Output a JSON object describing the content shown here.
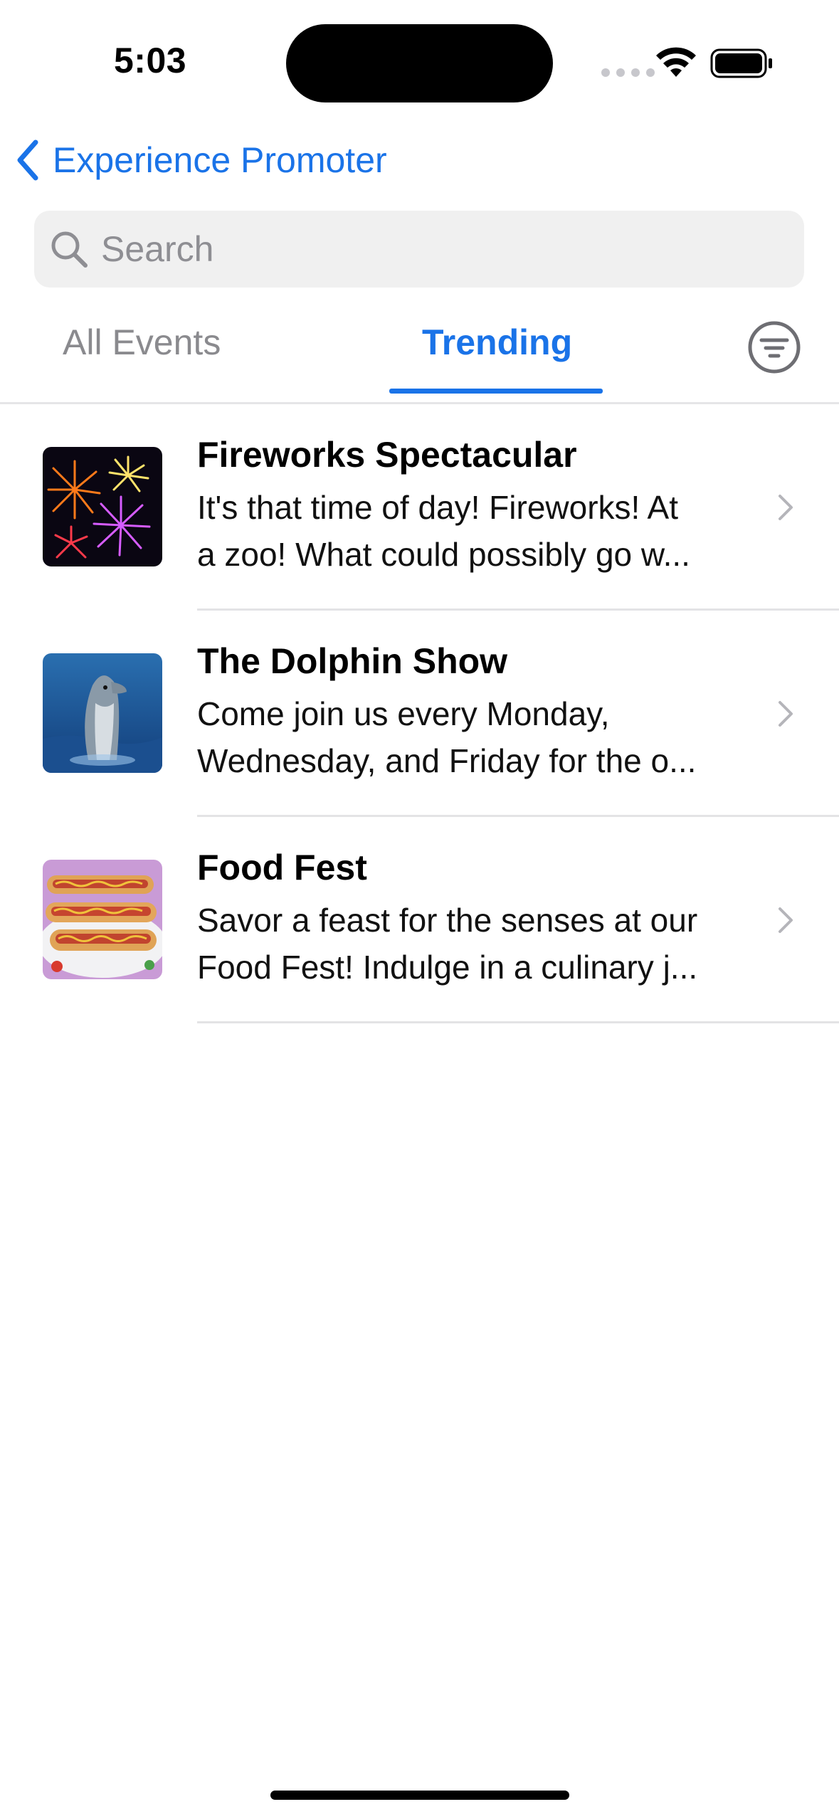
{
  "status_bar": {
    "time": "5:03"
  },
  "nav": {
    "back_label": "Experience Promoter"
  },
  "search": {
    "placeholder": "Search"
  },
  "tabs": [
    {
      "label": "All Events",
      "selected": false
    },
    {
      "label": "Trending",
      "selected": true
    }
  ],
  "events": [
    {
      "title": "Fireworks Spectacular",
      "line1": "It's that time of day! Fireworks! At",
      "line2": "a zoo! What could possibly go w..."
    },
    {
      "title": "The Dolphin Show",
      "line1": "Come join us every Monday,",
      "line2": "Wednesday, and Friday for the o..."
    },
    {
      "title": "Food Fest",
      "line1": "Savor a feast for the senses at our",
      "line2": "Food Fest! Indulge in a culinary j..."
    }
  ],
  "colors": {
    "accent": "#1a73e8",
    "inactive_tab": "#8a8a8e",
    "search_bg": "#f0f0f0"
  },
  "icons": [
    "chevron-left-icon",
    "search-icon",
    "filter-icon",
    "chevron-right-icon",
    "wifi-icon",
    "battery-icon"
  ]
}
